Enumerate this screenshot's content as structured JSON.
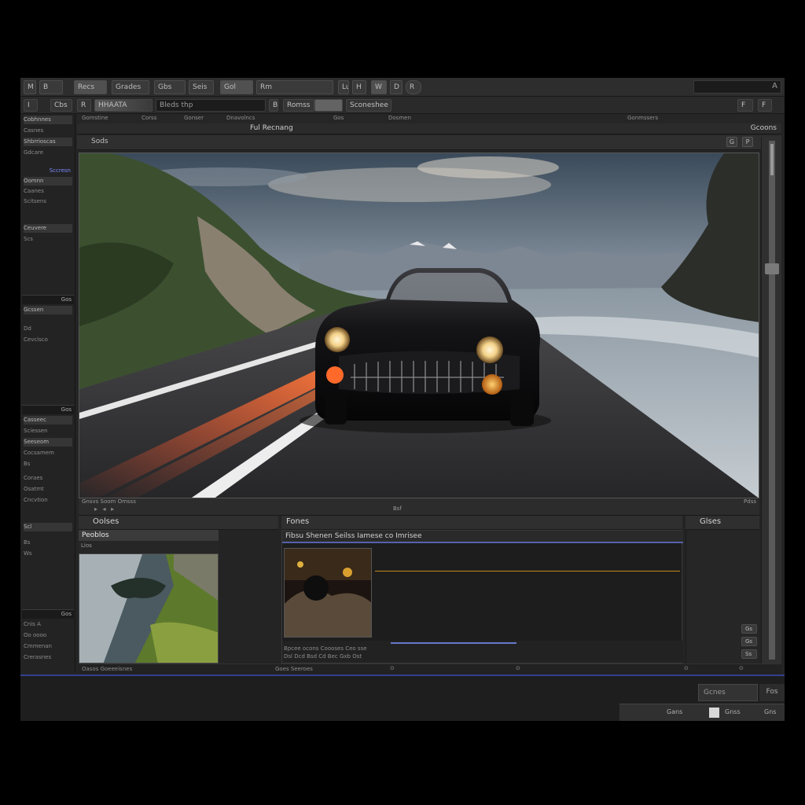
{
  "menubar": {
    "items": [
      "M",
      "B",
      "Recs",
      "Grades",
      "Gbs",
      "Seis",
      "Gol",
      "Rm",
      "Luces",
      "H",
      "W",
      "D",
      "R"
    ],
    "search_icon": "A"
  },
  "toolbar": {
    "left": [
      "I",
      "Cbs",
      "R",
      "WFTAR",
      "Bleds thp",
      "B",
      "Romss",
      "Sconeshee",
      "F",
      "F"
    ],
    "active_field": "HHAATA"
  },
  "left_panel": {
    "rows_a": [
      "Cobhnnes",
      "Casnes",
      "Shbrrioscas",
      "Gdcare",
      "Sccresn",
      "Oomnn",
      "Caanes",
      "Scitsens",
      "Ceuvere",
      "Scs"
    ],
    "section_b": "Gos",
    "rows_b": [
      "Gcssen",
      "Dd",
      "Cevcisco"
    ],
    "section_c": "Gos",
    "rows_c": [
      "Casseec",
      "Sciessen",
      "Seeseom",
      "Cocsamem",
      "Bs",
      "Coraes",
      "Osatmt",
      "Cncvtion",
      "Scl",
      "Bs",
      "Ws"
    ],
    "section_d": "Gos",
    "rows_d": [
      "Cnis A",
      "Oo oooo",
      "Cmmenan",
      "Crerasnes"
    ]
  },
  "viewer": {
    "panel_tabs": [
      "Gomstine",
      "Corss",
      "Gonser",
      "Dnavolncs",
      "Gos",
      "Dosmen",
      "Gonmssers"
    ],
    "title": "Ful Recnang",
    "right_label": "Gcoons",
    "sub_label": "Sods",
    "sub_btn_a": "G",
    "sub_btn_b": "P",
    "footer_left": "Gnsvs Soom Omsss",
    "footer_mid": "Bsf",
    "footer_right": "Pdss",
    "footer_icons": "▸ ◂ ▸"
  },
  "browser": {
    "header_title": "Oolses",
    "selected": "Peoblos",
    "thumb_label": "Lios"
  },
  "timeline": {
    "header_title": "Fones",
    "title": "Fibsu Shenen Seilss Iamese co Imrisee",
    "foot_row_1": "Bpcee  ocons  Coooses  Ceo sse",
    "foot_row_2": "Dsl  Dcd  Bsd  Cd  Bec  Gxb  Ost"
  },
  "props": {
    "header_title": "Glses",
    "buttons": [
      "Gs",
      "Gs",
      "Ss"
    ]
  },
  "status": {
    "left": "Oasos Goeeeisnes",
    "mid": "Goes Seeroes",
    "right_items": [
      "⊙",
      "⊙",
      "⊙",
      "⊙"
    ]
  },
  "bottom": {
    "btn_a": "Gcnes",
    "btn_b": "Fos",
    "status_a": "Gans",
    "status_b": "Gnss",
    "status_c": "Gns"
  },
  "colors": {
    "accent": "#31408e",
    "timeline_accent": "#5561a8",
    "playhead": "#c28a1e"
  }
}
